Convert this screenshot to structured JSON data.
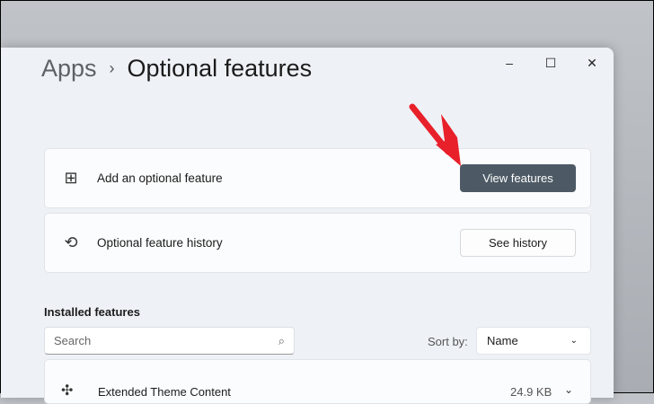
{
  "window": {
    "minimize": "–",
    "maximize": "☐",
    "close": "✕"
  },
  "breadcrumb": {
    "parent": "Apps",
    "separator": "›",
    "current": "Optional features"
  },
  "cards": [
    {
      "label": "Add an optional feature",
      "button": "View features",
      "icon": "add-feature-icon"
    },
    {
      "label": "Optional feature history",
      "button": "See history",
      "icon": "history-icon"
    }
  ],
  "installed": {
    "title": "Installed features",
    "search_placeholder": "Search",
    "sort_label": "Sort by:",
    "sort_value": "Name",
    "items": [
      {
        "name": "Extended Theme Content",
        "size": "24.9 KB"
      }
    ]
  },
  "annotation_color": "#e8202a"
}
